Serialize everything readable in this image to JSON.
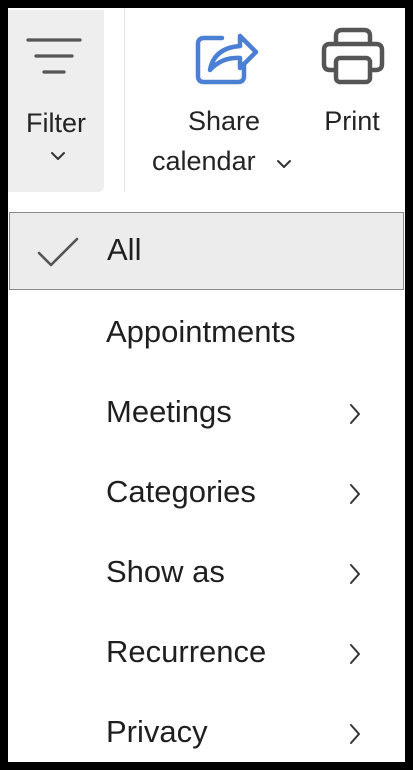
{
  "ribbon": {
    "filter": {
      "label": "Filter",
      "icon": "filter-lines-icon"
    },
    "share_calendar": {
      "label_line1": "Share",
      "label_line2": "calendar",
      "icon": "share-arrow-icon"
    },
    "print": {
      "label": "Print",
      "icon": "printer-icon"
    }
  },
  "filter_menu": {
    "items": [
      {
        "label": "All",
        "checked": true,
        "has_submenu": false
      },
      {
        "label": "Appointments",
        "checked": false,
        "has_submenu": false
      },
      {
        "label": "Meetings",
        "checked": false,
        "has_submenu": true
      },
      {
        "label": "Categories",
        "checked": false,
        "has_submenu": true
      },
      {
        "label": "Show as",
        "checked": false,
        "has_submenu": true
      },
      {
        "label": "Recurrence",
        "checked": false,
        "has_submenu": true
      },
      {
        "label": "Privacy",
        "checked": false,
        "has_submenu": true
      }
    ]
  },
  "colors": {
    "accent": "#4a7fd4",
    "text": "#242424",
    "selected_bg": "#ececec",
    "icon_gray": "#555555"
  }
}
